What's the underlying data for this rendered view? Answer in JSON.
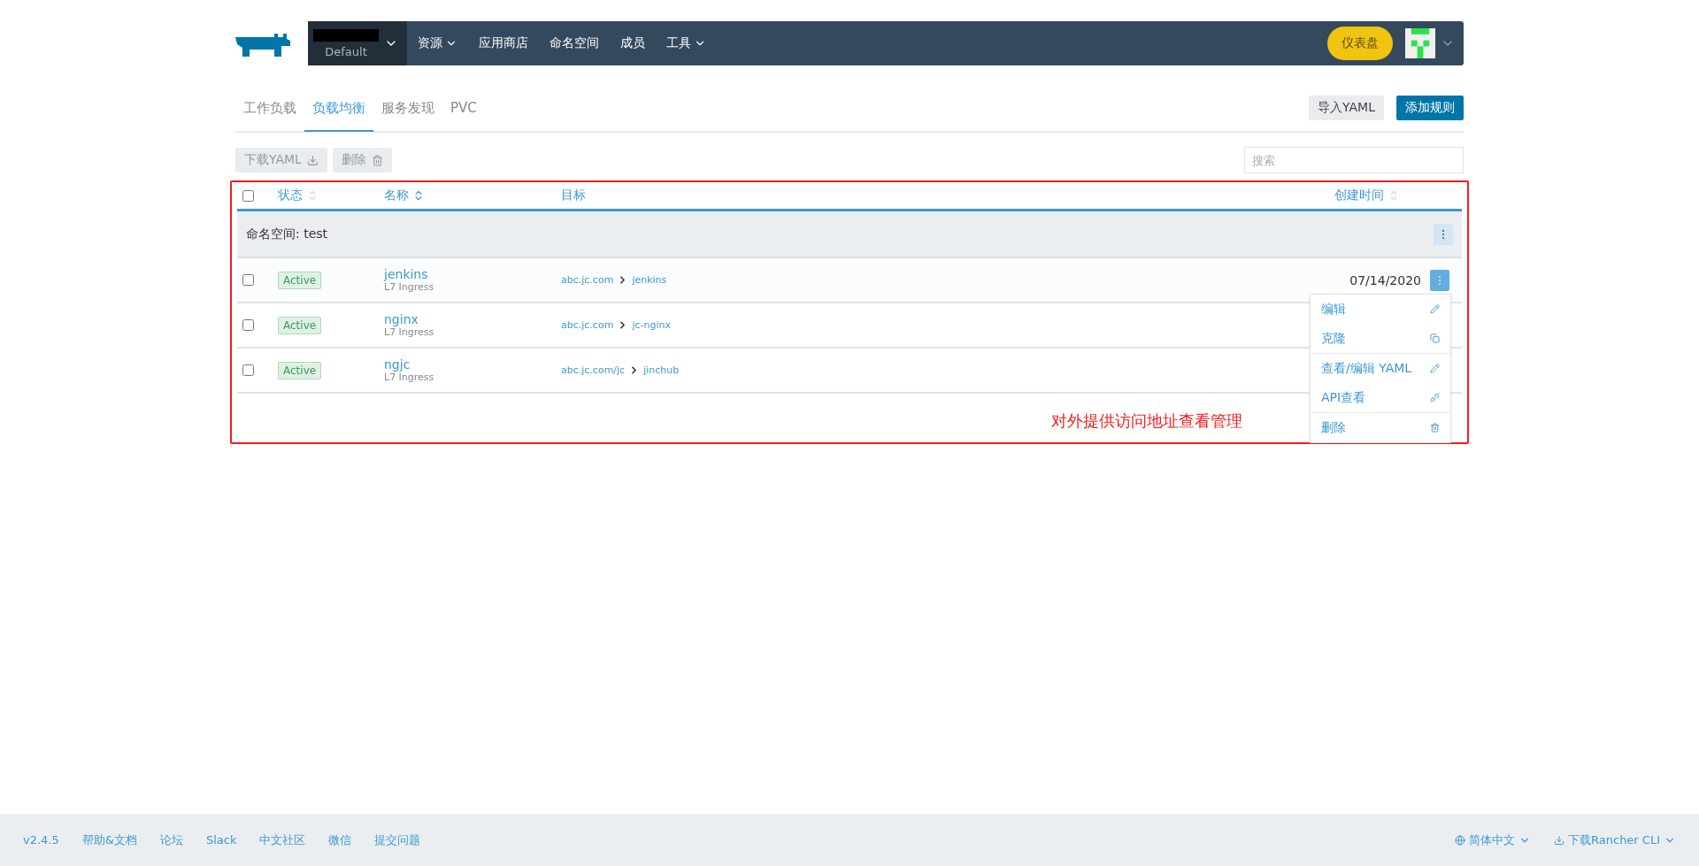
{
  "header": {
    "cluster": {
      "name": "Default"
    },
    "nav": [
      {
        "label": "资源",
        "dropdown": true
      },
      {
        "label": "应用商店",
        "dropdown": false
      },
      {
        "label": "命名空间",
        "dropdown": false
      },
      {
        "label": "成员",
        "dropdown": false
      },
      {
        "label": "工具",
        "dropdown": true
      }
    ],
    "dashboard_button": "仪表盘"
  },
  "tabs": [
    {
      "label": "工作负载",
      "selected": false
    },
    {
      "label": "负载均衡",
      "selected": true
    },
    {
      "label": "服务发现",
      "selected": false
    },
    {
      "label": "PVC",
      "selected": false
    }
  ],
  "actions": {
    "import": "导入YAML",
    "add": "添加规则"
  },
  "toolbar": {
    "download": "下载YAML",
    "delete": "删除",
    "search": {
      "placeholder": "搜索"
    }
  },
  "table": {
    "all_checked": false,
    "columns": [
      {
        "label": "状态",
        "sorted": false
      },
      {
        "label": "名称",
        "sorted": true
      },
      {
        "label": "目标"
      },
      {
        "label": "创建时间",
        "sorted": false
      }
    ],
    "group": "命名空间: test",
    "rows": [
      {
        "checked": false,
        "state": "Active",
        "name": "jenkins",
        "type": "L7 Ingress",
        "host": "abc.jc.com",
        "service": "jenkins",
        "created": "07/14/2020",
        "menu_open": true
      },
      {
        "checked": false,
        "state": "Active",
        "name": "nginx",
        "type": "L7 Ingress",
        "host": "abc.jc.com",
        "service": "jc-nginx",
        "menu_open": false
      },
      {
        "checked": false,
        "state": "Active",
        "name": "ngjc",
        "type": "L7 Ingress",
        "host": "abc.jc.com/jc",
        "service": "jinchub",
        "menu_open": false
      }
    ]
  },
  "menu": [
    {
      "label": "编辑",
      "divider_after": false
    },
    {
      "label": "克隆",
      "divider_after": true
    },
    {
      "label": "查看/编辑 YAML",
      "divider_after": false
    },
    {
      "label": "API查看",
      "divider_after": true
    },
    {
      "label": "删除",
      "divider_after": false
    }
  ],
  "annotation": "对外提供访问地址查看管理",
  "footer": {
    "links": [
      "v2.4.5",
      "帮助&文档",
      "论坛",
      "Slack",
      "中文社区",
      "微信",
      "提交问题"
    ],
    "language": "简体中文",
    "cli": "下载Rancher CLI"
  }
}
